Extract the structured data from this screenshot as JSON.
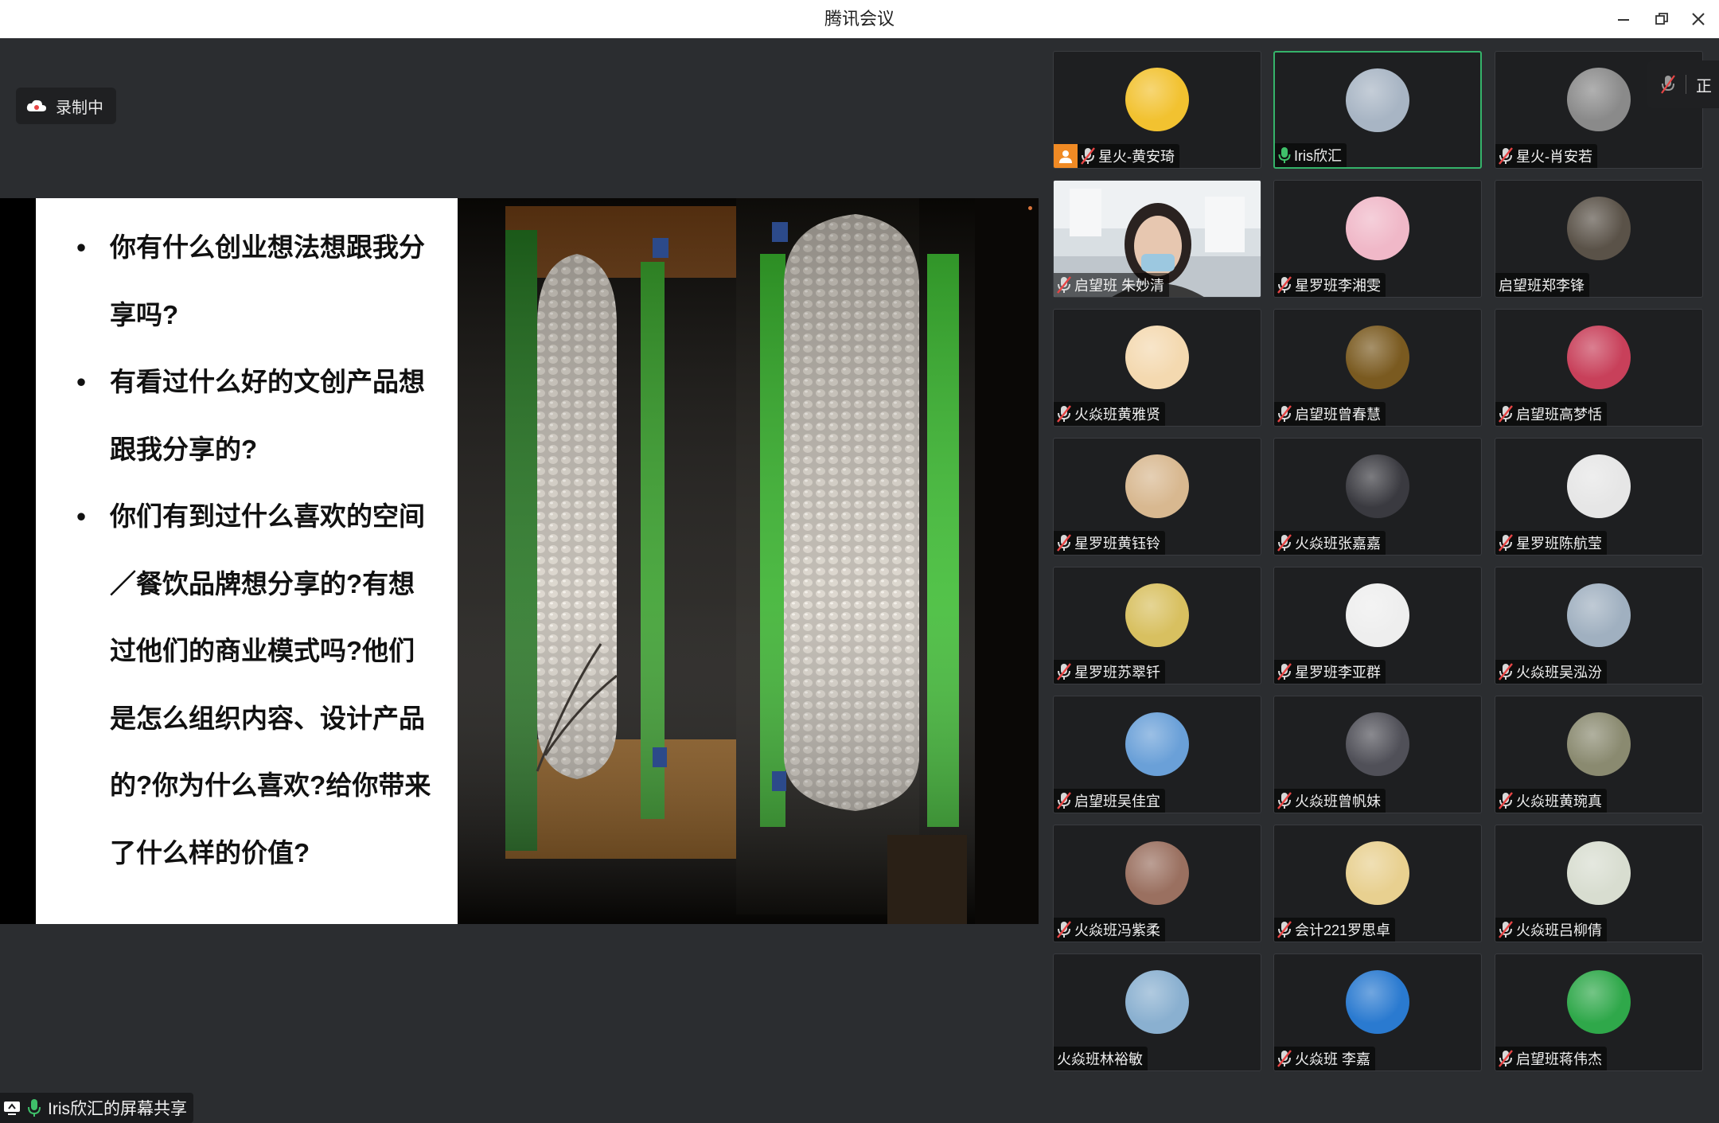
{
  "window": {
    "title": "腾讯会议"
  },
  "recording": {
    "label": "录制中"
  },
  "slide": {
    "bullets": [
      {
        "bullet": "•",
        "text": "你有什么创业想法想跟我分享吗?"
      },
      {
        "bullet": "•",
        "text": "有看过什么好的文创产品想跟我分享的?"
      },
      {
        "bullet": "•",
        "text": "你们有到过什么喜欢的空间／餐饮品牌想分享的?有想过他们的商业模式吗?他们是怎么组织内容、设计产品的?你为什么喜欢?给你带来了什么样的价值?"
      }
    ]
  },
  "share": {
    "label": "Iris欣汇的屏幕共享"
  },
  "edge_badge": {
    "label": "正"
  },
  "participants": [
    {
      "name": "星火-黄安琦",
      "mic": "muted",
      "host": true,
      "avatar_color": "#f2c230"
    },
    {
      "name": "Iris欣汇",
      "mic": "active",
      "speaking": true,
      "avatar_color": "#a8b5c4"
    },
    {
      "name": "星火-肖安若",
      "mic": "muted",
      "avatar_color": "#8a8a8a"
    },
    {
      "name": "启望班 朱妙清",
      "mic": "muted",
      "video": true,
      "avatar_color": "#c9d2d8"
    },
    {
      "name": "星罗班李湘雯",
      "mic": "muted",
      "avatar_color": "#f0b8c8"
    },
    {
      "name": "启望班郑李锋",
      "mic": "none",
      "avatar_color": "#5a5248"
    },
    {
      "name": "火焱班黄雅贤",
      "mic": "muted",
      "avatar_color": "#f4d9b0"
    },
    {
      "name": "启望班曾春慧",
      "mic": "muted",
      "avatar_color": "#7a5a20"
    },
    {
      "name": "启望班高梦恬",
      "mic": "muted",
      "avatar_color": "#c8405a"
    },
    {
      "name": "星罗班黄钰铃",
      "mic": "muted",
      "avatar_color": "#d8b890"
    },
    {
      "name": "火焱班张嘉嘉",
      "mic": "muted",
      "avatar_color": "#3a3a40"
    },
    {
      "name": "星罗班陈航莹",
      "mic": "muted",
      "avatar_color": "#e6e6e6"
    },
    {
      "name": "星罗班苏翠钎",
      "mic": "muted",
      "avatar_color": "#d8c060"
    },
    {
      "name": "星罗班李亚群",
      "mic": "muted",
      "avatar_color": "#eeeeee"
    },
    {
      "name": "火焱班吴泓汾",
      "mic": "muted",
      "avatar_color": "#a0b0c0"
    },
    {
      "name": "启望班吴佳宜",
      "mic": "muted",
      "avatar_color": "#6aa0d8"
    },
    {
      "name": "火焱班曾帆妹",
      "mic": "muted",
      "avatar_color": "#505058"
    },
    {
      "name": "火焱班黄琬真",
      "mic": "muted",
      "avatar_color": "#8a8a70"
    },
    {
      "name": "火焱班冯紫柔",
      "mic": "muted",
      "avatar_color": "#9a7060"
    },
    {
      "name": "会计221罗思卓",
      "mic": "muted",
      "avatar_color": "#e8d090"
    },
    {
      "name": "火焱班吕柳倩",
      "mic": "muted",
      "avatar_color": "#d8ddd0"
    },
    {
      "name": "火焱班林裕敏",
      "mic": "none",
      "avatar_color": "#8ab0d0"
    },
    {
      "name": "火焱班 李嘉",
      "mic": "muted",
      "avatar_color": "#2a7ad0"
    },
    {
      "name": "启望班蒋伟杰",
      "mic": "muted",
      "avatar_color": "#2fa84a"
    }
  ]
}
